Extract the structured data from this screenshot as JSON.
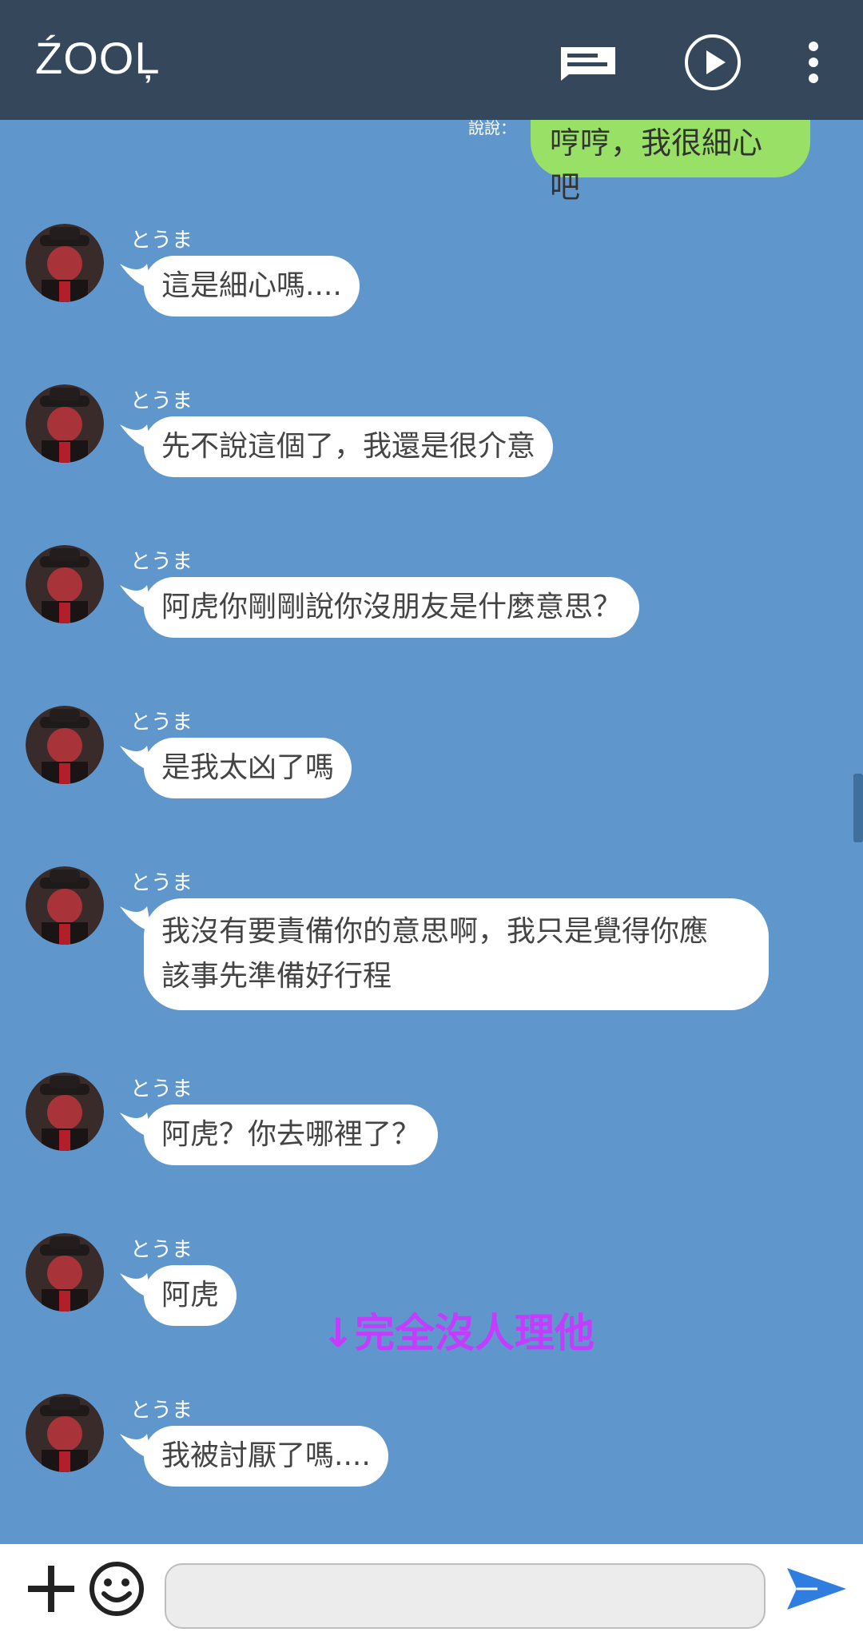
{
  "header": {
    "title": "ŹOOĻ",
    "icons": [
      "message-icon",
      "play-icon",
      "more-icon"
    ]
  },
  "chat": {
    "my_last": {
      "read_mark": "說說：",
      "text": "哼哼，我很細心吧"
    },
    "messages": [
      {
        "sender": "とうま",
        "text": "這是細心嗎...."
      },
      {
        "sender": "とうま",
        "text": "先不說這個了，我還是很介意"
      },
      {
        "sender": "とうま",
        "text": "阿虎你剛剛說你沒朋友是什麼意思？"
      },
      {
        "sender": "とうま",
        "text": "是我太凶了嗎"
      },
      {
        "sender": "とうま",
        "text": "我沒有要責備你的意思啊，我只是覺得你應該事先準備好行程"
      },
      {
        "sender": "とうま",
        "text": "阿虎？你去哪裡了？"
      },
      {
        "sender": "とうま",
        "text": "阿虎"
      },
      {
        "sender": "とうま",
        "text": "我被討厭了嗎...."
      }
    ],
    "annotation": "↓完全沒人理他"
  },
  "composer": {
    "placeholder": "",
    "icons": [
      "plus-icon",
      "emoji-icon",
      "send-icon"
    ]
  },
  "colors": {
    "header_bg": "#34475b",
    "chat_bg": "#5f97cc",
    "my_bubble": "#99e066",
    "their_bubble": "#ffffff",
    "annotation": "#c43cff",
    "send": "#2f7de1"
  }
}
